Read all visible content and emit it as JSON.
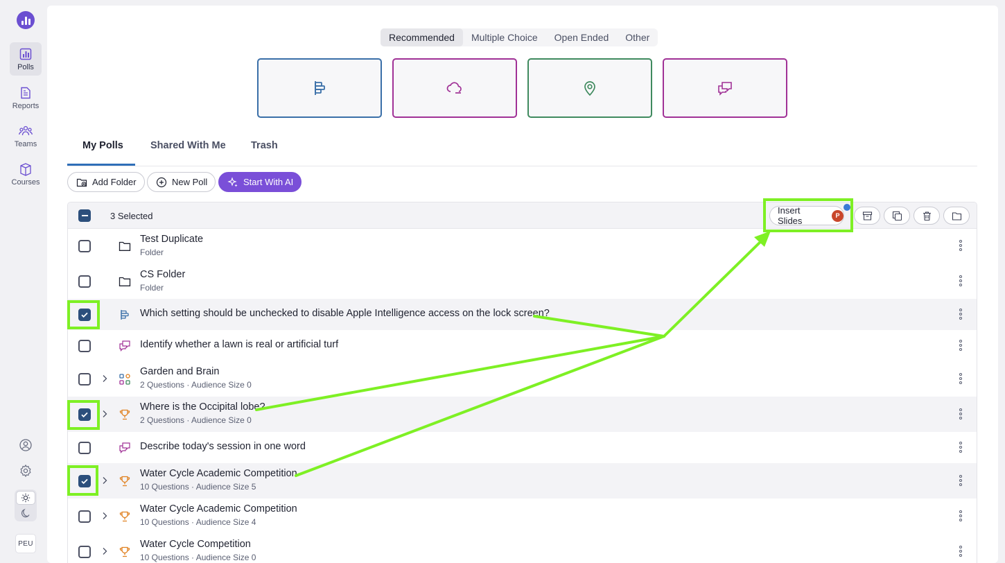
{
  "sidebar": {
    "items": [
      {
        "label": "Polls",
        "icon": "polls-icon"
      },
      {
        "label": "Reports",
        "icon": "reports-icon"
      },
      {
        "label": "Teams",
        "icon": "teams-icon"
      },
      {
        "label": "Courses",
        "icon": "courses-icon"
      }
    ],
    "avatar": "PEU"
  },
  "poll_types": {
    "tabs": [
      "Recommended",
      "Multiple Choice",
      "Open Ended",
      "Other"
    ],
    "active": "Recommended",
    "cards": [
      {
        "icon": "bar-chart-icon",
        "color": "#3a6fa8"
      },
      {
        "icon": "word-cloud-icon",
        "color": "#a03196"
      },
      {
        "icon": "map-pin-icon",
        "color": "#3f8a5e"
      },
      {
        "icon": "chat-bubbles-icon",
        "color": "#a03196"
      }
    ]
  },
  "library_tabs": [
    "My Polls",
    "Shared With Me",
    "Trash"
  ],
  "toolbar": {
    "add_folder": "Add Folder",
    "new_poll": "New Poll",
    "start_ai": "Start With AI"
  },
  "table": {
    "selected_count": "3 Selected",
    "insert_slides": "Insert Slides",
    "ppt_badge": "P",
    "rows": [
      {
        "title": "Test Duplicate",
        "sub": "Folder",
        "checked": false
      },
      {
        "title": "CS Folder",
        "sub": "Folder",
        "checked": false
      },
      {
        "title": "Which setting should be unchecked to disable Apple Intelligence access on the lock screen?",
        "sub": "",
        "checked": true
      },
      {
        "title": "Identify whether a lawn is real or artificial turf",
        "sub": "",
        "checked": false
      },
      {
        "title": "Garden and Brain",
        "sub": "2 Questions · Audience Size 0",
        "checked": false
      },
      {
        "title": "Where is the Occipital lobe?",
        "sub": "2 Questions · Audience Size 0",
        "checked": true
      },
      {
        "title": "Describe today's session in one word",
        "sub": "",
        "checked": false
      },
      {
        "title": "Water Cycle Academic Competition",
        "sub": "10 Questions · Audience Size 5",
        "checked": true
      },
      {
        "title": "Water Cycle Academic Competition",
        "sub": "10 Questions · Audience Size 4",
        "checked": false
      },
      {
        "title": "Water Cycle Competition",
        "sub": "10 Questions · Audience Size 0",
        "checked": false
      }
    ]
  },
  "colors": {
    "accent": "#7a4fd8",
    "checkbox": "#2c4f7c",
    "annotation": "#7ef024"
  }
}
